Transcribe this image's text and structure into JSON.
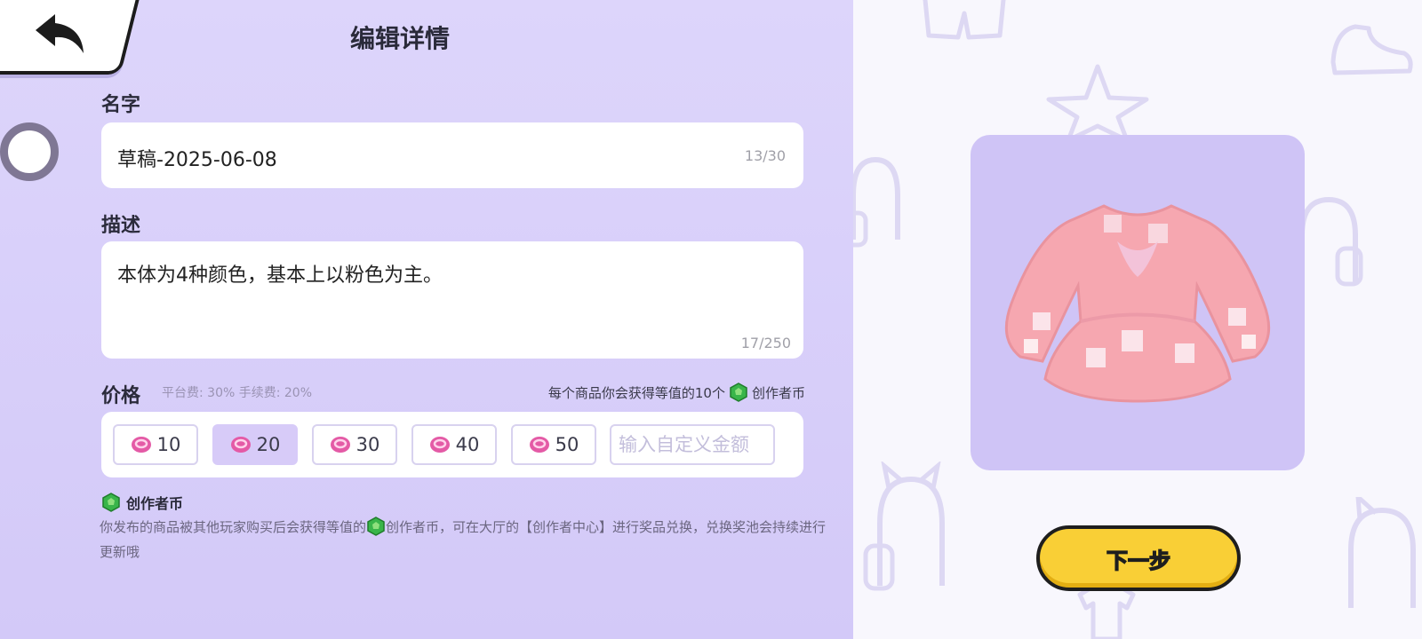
{
  "page_title": "编辑详情",
  "name_field": {
    "label": "名字",
    "value": "草稿-2025-06-08",
    "counter": "13/30"
  },
  "description_field": {
    "label": "描述",
    "value": "本体为4种颜色，基本上以粉色为主。",
    "counter": "17/250"
  },
  "price": {
    "label": "价格",
    "fee_note": "平台费: 30% 手续费: 20%",
    "earn_note_prefix": "每个商品你会获得等值的10个",
    "earn_note_suffix": "创作者币",
    "options": [
      "10",
      "20",
      "30",
      "40",
      "50"
    ],
    "selected": "20",
    "custom_placeholder": "输入自定义金额"
  },
  "creator_coin_info": {
    "title": "创作者币",
    "body_prefix": "你发布的商品被其他玩家购买后会获得等值的",
    "body_suffix": "创作者币，可在大厅的【创作者中心】进行奖品兑换，兑换奖池会持续进行更新哦"
  },
  "next_button": "下一步",
  "colors": {
    "panel_bg": "#d9d0fa",
    "preview_bg": "#cfc4f6",
    "selected_price": "#d7cbf8",
    "next_button": "#f9cf36",
    "coin_pink": "#e45aa6",
    "gem_green": "#39b54a"
  },
  "icons": [
    "back-arrow-icon",
    "coin-icon",
    "creator-gem-icon",
    "dress-preview"
  ]
}
